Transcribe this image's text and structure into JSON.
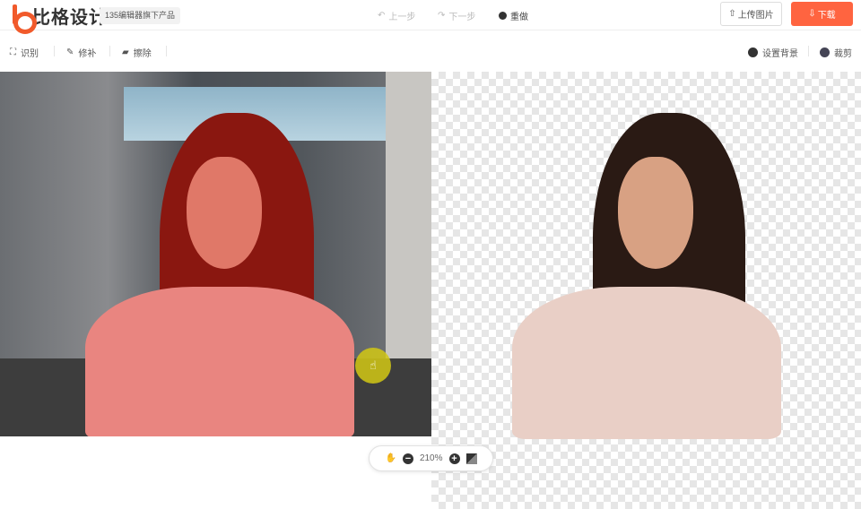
{
  "header": {
    "logo": "比格设计",
    "badge": "135编辑器旗下产品",
    "undo": "上一步",
    "redo": "下一步",
    "reset": "重做",
    "upload": "上传图片",
    "download": "下载"
  },
  "toolbar": {
    "identify": "识别",
    "repair": "修补",
    "erase": "擦除",
    "set_background": "设置背景",
    "crop": "裁剪"
  },
  "zoom": {
    "level": "210%"
  },
  "colors": {
    "accent": "#ff6440",
    "logo": "#f15a2b"
  }
}
